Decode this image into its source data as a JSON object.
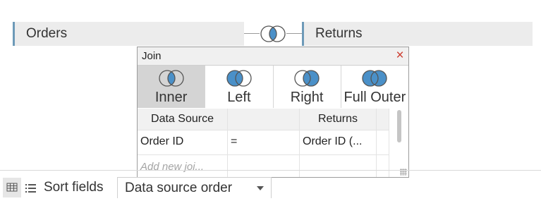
{
  "tables": {
    "left": "Orders",
    "right": "Returns"
  },
  "dialog": {
    "title": "Join",
    "close_icon": "×",
    "join_types": [
      {
        "label": "Inner",
        "icon": "inner-join-icon",
        "selected": true
      },
      {
        "label": "Left",
        "icon": "left-join-icon",
        "selected": false
      },
      {
        "label": "Right",
        "icon": "right-join-icon",
        "selected": false
      },
      {
        "label": "Full Outer",
        "icon": "full-outer-join-icon",
        "selected": false
      }
    ],
    "conditions": {
      "headers": {
        "left": "Data Source",
        "operator": "",
        "right": "Returns"
      },
      "rows": [
        {
          "left": "Order ID",
          "operator": "=",
          "right": "Order ID (..."
        }
      ],
      "add_placeholder": "Add new joi..."
    }
  },
  "bottom_bar": {
    "sort_label": "Sort fields",
    "sort_value": "Data source order"
  },
  "colors": {
    "venn_fill": "#4a90c8",
    "venn_outline": "#555555",
    "close": "#cc3b2e",
    "pill_accent": "#6d9ab8"
  }
}
